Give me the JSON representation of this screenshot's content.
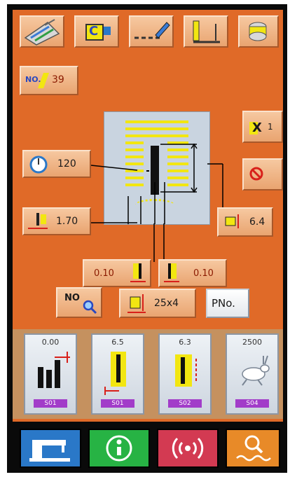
{
  "toolbar": {
    "icons": [
      "threads-icon",
      "clamp-c-icon",
      "pencil-line-icon",
      "presser-foot-icon",
      "bobbin-winder-icon"
    ],
    "clamp_letter": "C"
  },
  "pattern_no": {
    "label": "NO.",
    "value": "39"
  },
  "counter": {
    "label": "X",
    "value": "1"
  },
  "speed": {
    "value": "120"
  },
  "bartack_width": {
    "value": "1.70"
  },
  "bartack_length": {
    "value": "6.4"
  },
  "offset_left": {
    "value": "0.10"
  },
  "offset_right": {
    "value": "0.10"
  },
  "search_no": {
    "label": "NO"
  },
  "stitch_size": {
    "value": "25x4"
  },
  "pno": {
    "label": "PNo."
  },
  "pattern_buttons": [
    {
      "top": "0.00",
      "tag": "S01"
    },
    {
      "top": "6.5",
      "tag": "S01"
    },
    {
      "top": "6.3",
      "tag": "S02"
    },
    {
      "top": "2500",
      "tag": "S04"
    }
  ],
  "bottom_bar": [
    "sewing-machine-icon",
    "info-icon",
    "signal-icon",
    "search-pattern-icon"
  ],
  "colors": {
    "panel": "#e06a28",
    "stitch_yellow": "#f2e611",
    "bottom_blue": "#2a78c8",
    "bottom_green": "#27b344",
    "bottom_red": "#d33a52",
    "bottom_orange": "#e88a28"
  }
}
